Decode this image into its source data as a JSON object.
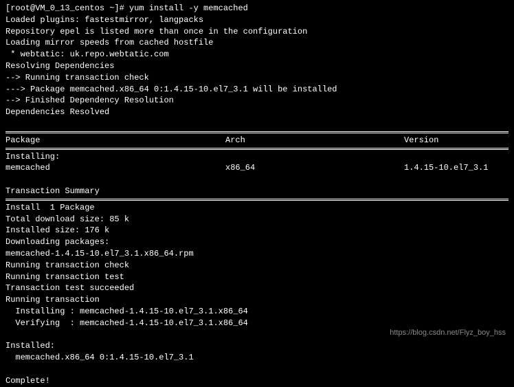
{
  "prompt": "[root@VM_0_13_centos ~]# yum install -y memcached",
  "output": {
    "l1": "Loaded plugins: fastestmirror, langpacks",
    "l2": "Repository epel is listed more than once in the configuration",
    "l3": "Loading mirror speeds from cached hostfile",
    "l4": " * webtatic: uk.repo.webtatic.com",
    "l5": "Resolving Dependencies",
    "l6": "--> Running transaction check",
    "l7": "---> Package memcached.x86_64 0:1.4.15-10.el7_3.1 will be installed",
    "l8": "--> Finished Dependency Resolution",
    "l9": "",
    "l10": "Dependencies Resolved"
  },
  "table": {
    "header": {
      "package": " Package",
      "arch": "Arch",
      "version": "Version"
    },
    "installing_label": "Installing:",
    "row": {
      "package": " memcached",
      "arch": "x86_64",
      "version": "1.4.15-10.el7_3.1"
    }
  },
  "summary": {
    "title": "Transaction Summary",
    "install": "Install  1 Package",
    "blank": "",
    "dl_size": "Total download size: 85 k",
    "inst_size": "Installed size: 176 k",
    "downloading": "Downloading packages:",
    "rpm": "memcached-1.4.15-10.el7_3.1.x86_64.rpm",
    "run_check": "Running transaction check",
    "run_test": "Running transaction test",
    "test_ok": "Transaction test succeeded",
    "run_trans": "Running transaction",
    "installing": "  Installing : memcached-1.4.15-10.el7_3.1.x86_64",
    "verifying": "  Verifying  : memcached-1.4.15-10.el7_3.1.x86_64",
    "installed_label": "Installed:",
    "installed_pkg": "  memcached.x86_64 0:1.4.15-10.el7_3.1",
    "complete": "Complete!"
  },
  "watermark": "https://blog.csdn.net/Flyz_boy_hss"
}
